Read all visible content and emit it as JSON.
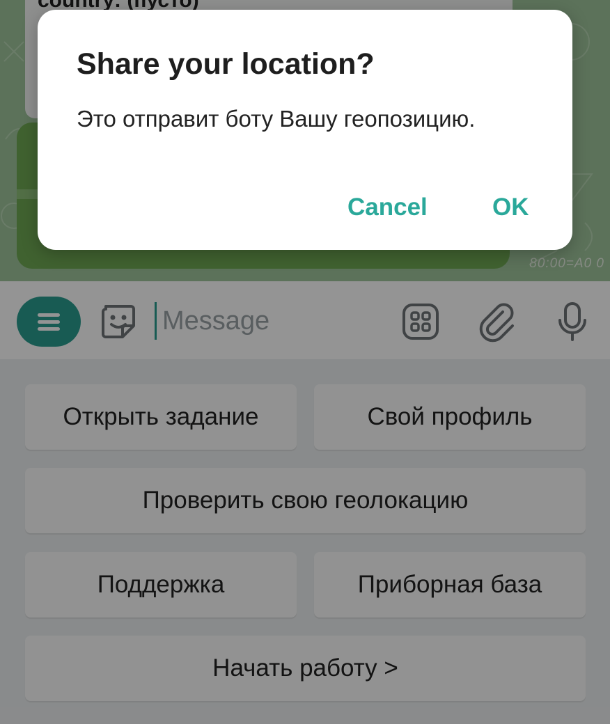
{
  "chat": {
    "partial_message_text": "country: (пусто)",
    "time_text": "80:00=A0 0"
  },
  "composer": {
    "placeholder": "Message",
    "icons": [
      "menu-icon",
      "sticker-icon",
      "bot-keyboard-icon",
      "attach-icon",
      "microphone-icon"
    ]
  },
  "keyboard": {
    "open_task": "Открыть задание",
    "my_profile": "Свой профиль",
    "check_location": "Проверить свою геолокацию",
    "support": "Поддержка",
    "device_base": "Приборная база",
    "start_work": "Начать работу >"
  },
  "dialog": {
    "title": "Share your location?",
    "body": "Это отправит боту Вашу геопозицию.",
    "cancel_label": "Cancel",
    "ok_label": "OK"
  },
  "colors": {
    "accent": "#2a9d8f",
    "dialog_button": "#2aa89a",
    "wallpaper": "#9fc49b",
    "inline_keyboard": "#6eaa54"
  }
}
